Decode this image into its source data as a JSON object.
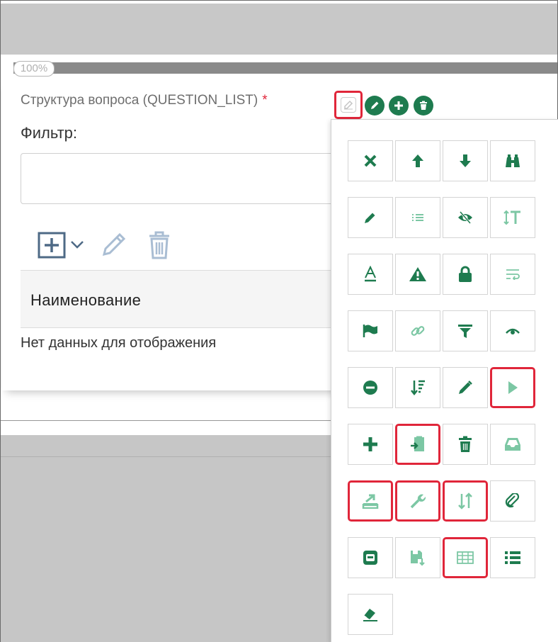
{
  "progress": {
    "label": "100%",
    "value": 1.0
  },
  "field": {
    "label": "Структура вопроса (QUESTION_LIST)",
    "required_mark": "*"
  },
  "filter": {
    "label": "Фильтр:",
    "value": ""
  },
  "grid": {
    "column_header": "Наименование",
    "empty_text": "Нет данных для отображения"
  },
  "colors": {
    "accent_green": "#1e7b4f",
    "light_green": "#7cc7a4",
    "highlight_red": "#e0263a",
    "toolbar_blue": "#4e6a86",
    "toolbar_light": "#a9bdd3"
  },
  "field_buttons": [
    "edit-icon",
    "pencil-icon",
    "plus-icon",
    "trash-icon"
  ],
  "palette_icons": [
    [
      "close-icon",
      "arrow-up-icon",
      "arrow-down-icon",
      "binoculars-icon"
    ],
    [
      "pencil-icon",
      "list-icon",
      "eye-slash-icon",
      "text-height-icon"
    ],
    [
      "font-icon",
      "warning-icon",
      "lock-icon",
      "wrap-text-icon"
    ],
    [
      "flag-icon",
      "link-icon",
      "filter-icon",
      "eye-icon"
    ],
    [
      "minus-circle-icon",
      "sort-amount-icon",
      "pencil-icon",
      "play-icon"
    ],
    [
      "plus-icon",
      "paste-icon",
      "trash-icon",
      "inbox-icon"
    ],
    [
      "export-icon",
      "wrench-icon",
      "sort-icon",
      "paperclip-icon"
    ],
    [
      "window-icon",
      "save-icon",
      "table-icon",
      "list-ul-icon"
    ],
    [
      "eraser-icon"
    ]
  ]
}
